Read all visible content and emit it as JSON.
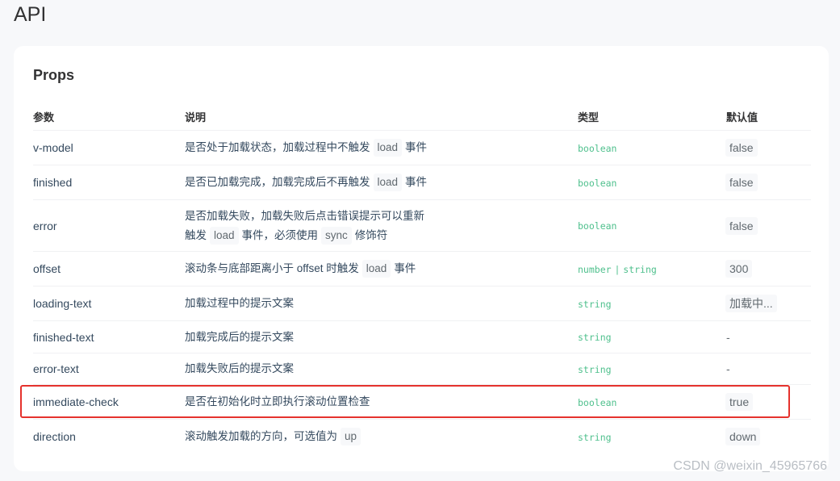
{
  "page": {
    "title": "API"
  },
  "props": {
    "section_title": "Props",
    "headers": [
      "参数",
      "说明",
      "类型",
      "默认值"
    ],
    "rows": [
      {
        "name": "v-model",
        "desc_pre": "是否处于加载状态，加载过程中不触发",
        "desc_code": "load",
        "desc_post": "事件",
        "type_a": "boolean",
        "type_b": "",
        "default": "false",
        "default_boxed": true
      },
      {
        "name": "finished",
        "desc_pre": "是否已加载完成，加载完成后不再触发",
        "desc_code": "load",
        "desc_post": "事件",
        "type_a": "boolean",
        "type_b": "",
        "default": "false",
        "default_boxed": true
      },
      {
        "name": "error",
        "desc_line1": "是否加载失败，加载失败后点击错误提示可以重新",
        "desc_pre": "触发",
        "desc_code": "load",
        "desc_mid": "事件，必须使用",
        "desc_code2": "sync",
        "desc_post": "修饰符",
        "type_a": "boolean",
        "type_b": "",
        "default": "false",
        "default_boxed": true
      },
      {
        "name": "offset",
        "desc_pre": "滚动条与底部距离小于 offset 时触发",
        "desc_code": "load",
        "desc_post": "事件",
        "type_a": "number",
        "type_sep": "|",
        "type_b": "string",
        "default": "300",
        "default_boxed": true
      },
      {
        "name": "loading-text",
        "desc_pre": "加载过程中的提示文案",
        "type_a": "string",
        "type_b": "",
        "default": "加载中...",
        "default_boxed": true
      },
      {
        "name": "finished-text",
        "desc_pre": "加载完成后的提示文案",
        "type_a": "string",
        "type_b": "",
        "default": "-",
        "default_boxed": false
      },
      {
        "name": "error-text",
        "desc_pre": "加载失败后的提示文案",
        "type_a": "string",
        "type_b": "",
        "default": "-",
        "default_boxed": false
      },
      {
        "name": "immediate-check",
        "desc_pre": "是否在初始化时立即执行滚动位置检查",
        "type_a": "boolean",
        "type_b": "",
        "default": "true",
        "default_boxed": true,
        "highlighted": true
      },
      {
        "name": "direction",
        "desc_pre": "滚动触发加载的方向，可选值为",
        "desc_code": "up",
        "type_a": "string",
        "type_b": "",
        "default": "down",
        "default_boxed": true
      }
    ]
  },
  "highlight_color": "#e5322d",
  "accent_color": "#4fc08d",
  "watermark": "CSDN @weixin_45965766"
}
